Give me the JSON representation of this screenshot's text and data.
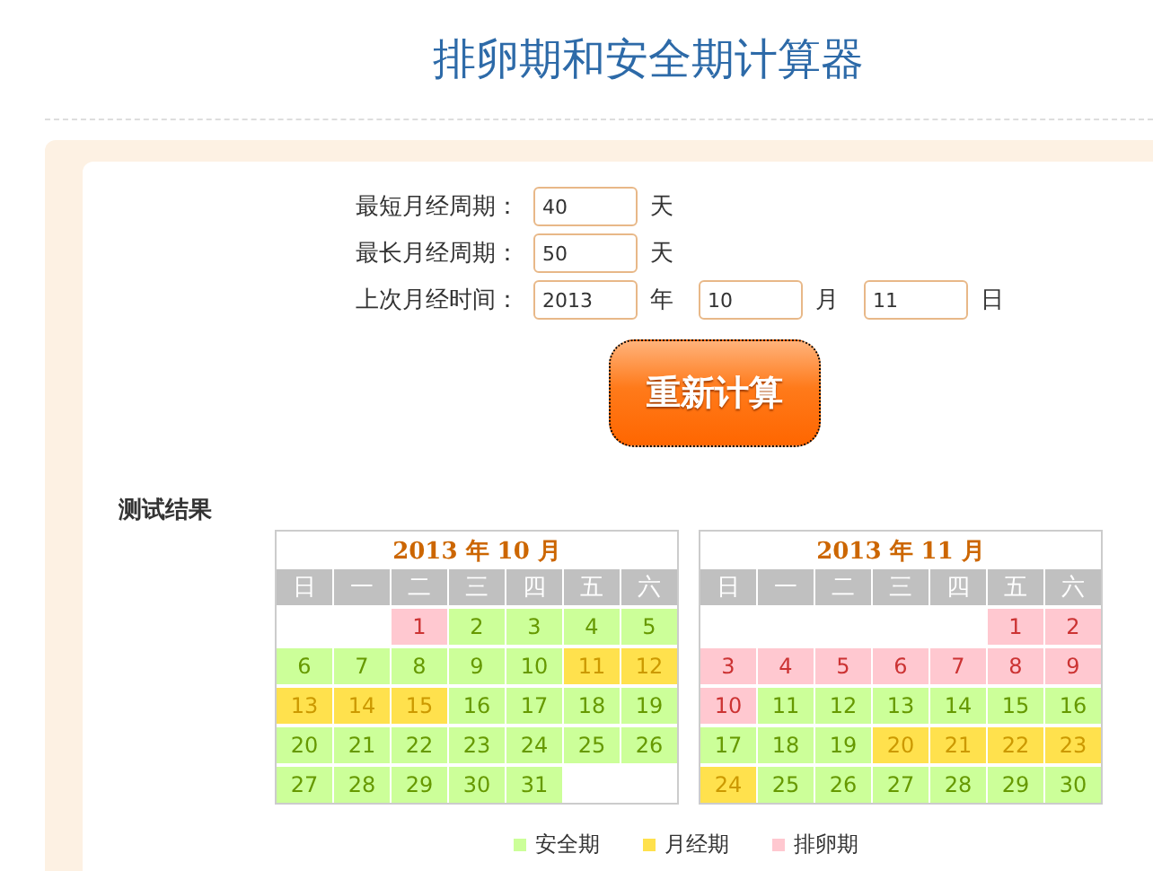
{
  "title": "排卵期和安全期计算器",
  "form": {
    "rows": [
      {
        "label": "最短月经周期：",
        "fields": [
          {
            "value": "40",
            "unit": "天"
          }
        ]
      },
      {
        "label": "最长月经周期：",
        "fields": [
          {
            "value": "50",
            "unit": "天"
          }
        ]
      },
      {
        "label": "上次月经时间：",
        "fields": [
          {
            "value": "2013",
            "unit": "年"
          },
          {
            "value": "10",
            "unit": "月"
          },
          {
            "value": "11",
            "unit": "日"
          }
        ]
      }
    ],
    "button": "重新计算"
  },
  "results": {
    "heading": "测试结果",
    "calendars": [
      {
        "title": "2013 年 10 月",
        "weekdays": [
          "日",
          "一",
          "二",
          "三",
          "四",
          "五",
          "六"
        ],
        "weeks": [
          [
            {
              "kind": "blank"
            },
            {
              "kind": "blank"
            },
            {
              "day": "1",
              "kind": "ovulation"
            },
            {
              "day": "2",
              "kind": "safe"
            },
            {
              "day": "3",
              "kind": "safe"
            },
            {
              "day": "4",
              "kind": "safe"
            },
            {
              "day": "5",
              "kind": "safe"
            }
          ],
          [
            {
              "day": "6",
              "kind": "safe"
            },
            {
              "day": "7",
              "kind": "safe"
            },
            {
              "day": "8",
              "kind": "safe"
            },
            {
              "day": "9",
              "kind": "safe"
            },
            {
              "day": "10",
              "kind": "safe"
            },
            {
              "day": "11",
              "kind": "period"
            },
            {
              "day": "12",
              "kind": "period"
            }
          ],
          [
            {
              "day": "13",
              "kind": "period"
            },
            {
              "day": "14",
              "kind": "period"
            },
            {
              "day": "15",
              "kind": "period"
            },
            {
              "day": "16",
              "kind": "safe"
            },
            {
              "day": "17",
              "kind": "safe"
            },
            {
              "day": "18",
              "kind": "safe"
            },
            {
              "day": "19",
              "kind": "safe"
            }
          ],
          [
            {
              "day": "20",
              "kind": "safe"
            },
            {
              "day": "21",
              "kind": "safe"
            },
            {
              "day": "22",
              "kind": "safe"
            },
            {
              "day": "23",
              "kind": "safe"
            },
            {
              "day": "24",
              "kind": "safe"
            },
            {
              "day": "25",
              "kind": "safe"
            },
            {
              "day": "26",
              "kind": "safe"
            }
          ],
          [
            {
              "day": "27",
              "kind": "safe"
            },
            {
              "day": "28",
              "kind": "safe"
            },
            {
              "day": "29",
              "kind": "safe"
            },
            {
              "day": "30",
              "kind": "safe"
            },
            {
              "day": "31",
              "kind": "safe"
            },
            {
              "kind": "blank"
            },
            {
              "kind": "blank"
            }
          ]
        ]
      },
      {
        "title": "2013 年 11 月",
        "weekdays": [
          "日",
          "一",
          "二",
          "三",
          "四",
          "五",
          "六"
        ],
        "weeks": [
          [
            {
              "kind": "blank"
            },
            {
              "kind": "blank"
            },
            {
              "kind": "blank"
            },
            {
              "kind": "blank"
            },
            {
              "kind": "blank"
            },
            {
              "day": "1",
              "kind": "ovulation"
            },
            {
              "day": "2",
              "kind": "ovulation"
            }
          ],
          [
            {
              "day": "3",
              "kind": "ovulation"
            },
            {
              "day": "4",
              "kind": "ovulation"
            },
            {
              "day": "5",
              "kind": "ovulation"
            },
            {
              "day": "6",
              "kind": "ovulation"
            },
            {
              "day": "7",
              "kind": "ovulation"
            },
            {
              "day": "8",
              "kind": "ovulation"
            },
            {
              "day": "9",
              "kind": "ovulation"
            }
          ],
          [
            {
              "day": "10",
              "kind": "ovulation"
            },
            {
              "day": "11",
              "kind": "safe"
            },
            {
              "day": "12",
              "kind": "safe"
            },
            {
              "day": "13",
              "kind": "safe"
            },
            {
              "day": "14",
              "kind": "safe"
            },
            {
              "day": "15",
              "kind": "safe"
            },
            {
              "day": "16",
              "kind": "safe"
            }
          ],
          [
            {
              "day": "17",
              "kind": "safe"
            },
            {
              "day": "18",
              "kind": "safe"
            },
            {
              "day": "19",
              "kind": "safe"
            },
            {
              "day": "20",
              "kind": "period"
            },
            {
              "day": "21",
              "kind": "period"
            },
            {
              "day": "22",
              "kind": "period"
            },
            {
              "day": "23",
              "kind": "period"
            }
          ],
          [
            {
              "day": "24",
              "kind": "period"
            },
            {
              "day": "25",
              "kind": "safe"
            },
            {
              "day": "26",
              "kind": "safe"
            },
            {
              "day": "27",
              "kind": "safe"
            },
            {
              "day": "28",
              "kind": "safe"
            },
            {
              "day": "29",
              "kind": "safe"
            },
            {
              "day": "30",
              "kind": "safe"
            }
          ]
        ]
      }
    ],
    "legend": [
      {
        "label": "安全期",
        "kind": "safe"
      },
      {
        "label": "月经期",
        "kind": "period"
      },
      {
        "label": "排卵期",
        "kind": "ovulation"
      }
    ]
  }
}
